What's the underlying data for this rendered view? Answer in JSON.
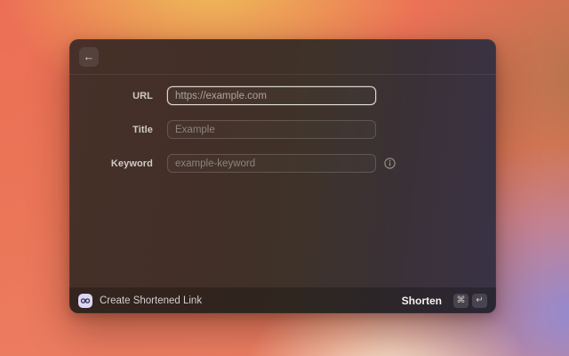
{
  "window": {
    "header": {
      "back_icon_glyph": "←"
    },
    "form": {
      "fields": [
        {
          "label": "URL",
          "placeholder": "https://example.com",
          "value": "",
          "state": "focused"
        },
        {
          "label": "Title",
          "placeholder": "Example",
          "value": "",
          "state": "default"
        },
        {
          "label": "Keyword",
          "placeholder": "example-keyword",
          "value": "",
          "state": "default",
          "info_icon": "circled-i"
        }
      ]
    },
    "footer": {
      "app_icon": "link-icon",
      "action_title": "Create Shortened Link",
      "primary_action": {
        "label": "Shorten",
        "shortcut_keys": [
          "⌘",
          "↵"
        ]
      }
    }
  },
  "colors": {
    "wallpaper_coral": "#ec6f55",
    "wallpaper_gold": "#eec558",
    "wallpaper_periwinkle": "#928ad2",
    "wallpaper_cream": "#f7efd8",
    "window_tint_left": "#463029",
    "window_tint_right": "#393246",
    "focused_border": "#f8f4f0",
    "app_icon_bg": "#dbd8f3",
    "app_icon_glyph": "#39325c"
  }
}
